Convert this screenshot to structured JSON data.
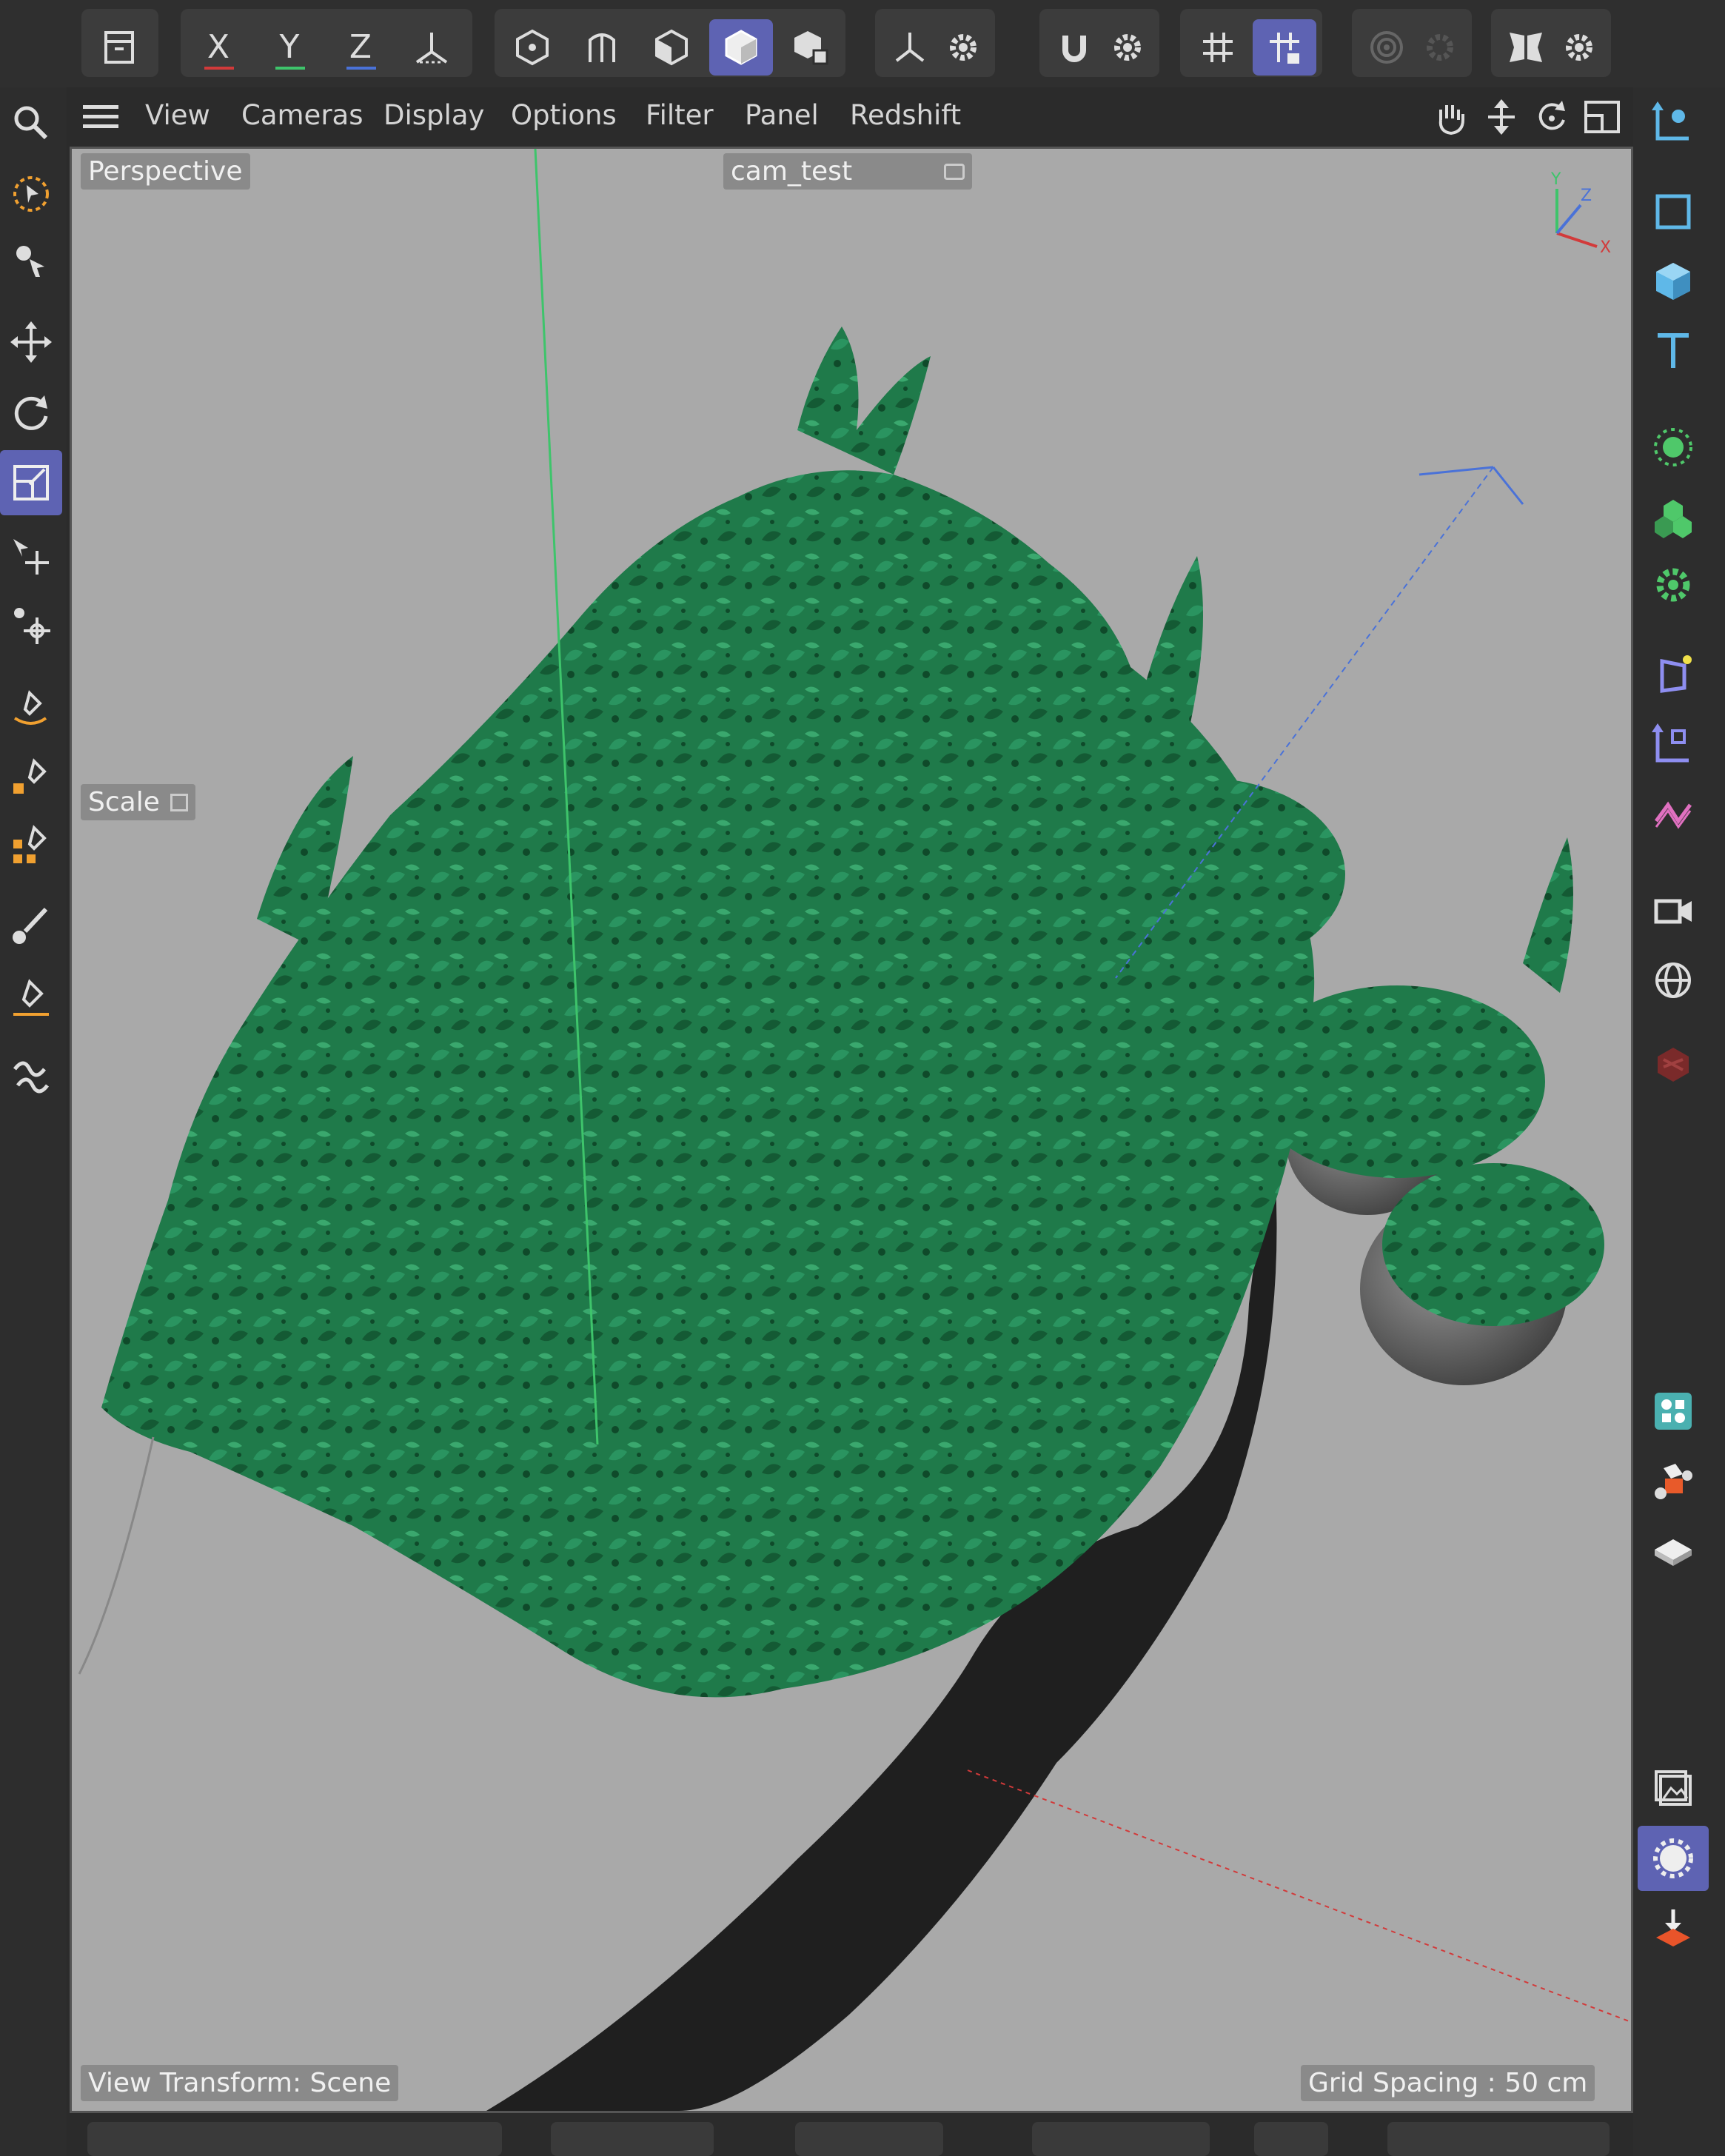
{
  "toolbar": {
    "axis_x": "X",
    "axis_y": "Y",
    "axis_z": "Z",
    "icons": [
      "undo-history-icon",
      "lock-x-axis",
      "lock-y-axis",
      "lock-z-axis",
      "coordinate-system-icon",
      "points-mode-icon",
      "edges-mode-icon",
      "polygons-mode-icon",
      "model-mode-icon",
      "object-mode-icon",
      "axis-mode-icon",
      "settings-gear-icon",
      "snap-magnet-icon",
      "snap-settings-gear-icon",
      "grid-snap-icon",
      "workplane-lock-icon",
      "soft-selection-icon",
      "symmetry-icon"
    ]
  },
  "menu": {
    "items": [
      "View",
      "Cameras",
      "Display",
      "Options",
      "Filter",
      "Panel",
      "Redshift"
    ]
  },
  "viewport": {
    "view_name": "Perspective",
    "camera_name": "cam_test",
    "tool_label": "Scale",
    "view_transform": "View Transform: Scene",
    "grid_spacing": "Grid Spacing : 50 cm",
    "axis_labels": {
      "x": "X",
      "y": "Y",
      "z": "Z"
    },
    "colors": {
      "background": "#a9a9a9",
      "foliage": "#1f7a4a",
      "foliage_dark": "#0f4a2a",
      "pot": "#6b6b6b",
      "shadow": "#141414",
      "x_axis": "#d23a3a",
      "y_axis": "#3ec46b",
      "z_axis": "#4a72d8"
    }
  },
  "left_tools": [
    "live-selection",
    "move-selection",
    "move",
    "rotate",
    "scale",
    "transfer",
    "place",
    "spline-pen",
    "spline-sketch",
    "spline-smooth",
    "brush",
    "pen-outline",
    "spline-tool"
  ],
  "right_tools": [
    "create-null",
    "cube",
    "text",
    "cloner",
    "mograph",
    "effector",
    "deformer",
    "spline-deformer",
    "field",
    "camera",
    "environment",
    "redshift",
    "scene-object",
    "material-manager",
    "floor",
    "picture-viewer",
    "render-settings",
    "render"
  ],
  "colors": {
    "accent": "#5e63b3",
    "panel": "#2d2d2d",
    "button_group": "#3c3c3c"
  }
}
